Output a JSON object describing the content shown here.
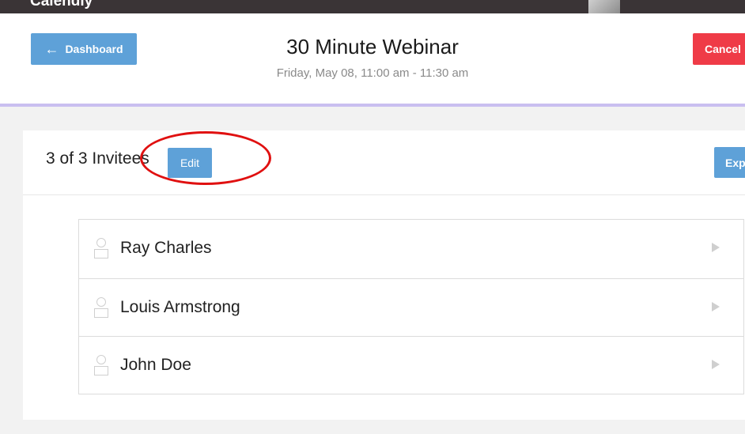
{
  "nav": {
    "brand": "Calendly",
    "user_name": ""
  },
  "header": {
    "dashboard_label": "Dashboard",
    "title": "30 Minute Webinar",
    "time": "Friday, May 08, 11:00 am - 11:30 am",
    "cancel_label": "Cancel"
  },
  "invitees": {
    "count_text": "3 of 3 Invitees",
    "edit_label": "Edit",
    "export_label": "Exp",
    "items": [
      {
        "name": "Ray Charles"
      },
      {
        "name": "Louis Armstrong"
      },
      {
        "name": "John Doe"
      }
    ]
  },
  "colors": {
    "accent": "#5ea1d8",
    "danger": "#ef3b47",
    "divider": "#c9bff0",
    "annotation": "#e01010"
  }
}
